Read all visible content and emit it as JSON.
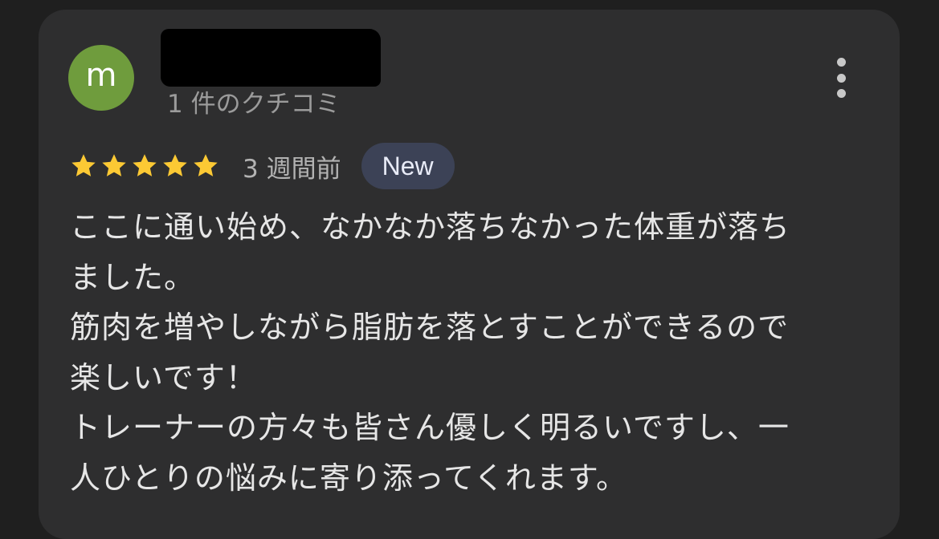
{
  "review": {
    "avatar_letter": "m",
    "author_name": "",
    "review_count": "1 件のクチコミ",
    "rating": 5,
    "rating_max": 5,
    "time_ago": "3 週間前",
    "badge": "New",
    "text_lines": [
      "ここに通い始め、なかなか落ちなかった体重が落ち",
      "ました。",
      "筋肉を増やしながら脂肪を落とすことができるので",
      "楽しいです！",
      "トレーナーの方々も皆さん優しく明るいですし、一",
      "人ひとりの悩みに寄り添ってくれます。"
    ]
  },
  "icons": {
    "more": "more-vertical-icon",
    "star": "star-icon"
  },
  "colors": {
    "background": "#1f1f1f",
    "card": "#2e2e2f",
    "avatar": "#6f9c3d",
    "star": "#fcc934",
    "badge_bg": "#3c4256",
    "text": "#e6e6e6",
    "muted_text": "#9b9b9b"
  }
}
